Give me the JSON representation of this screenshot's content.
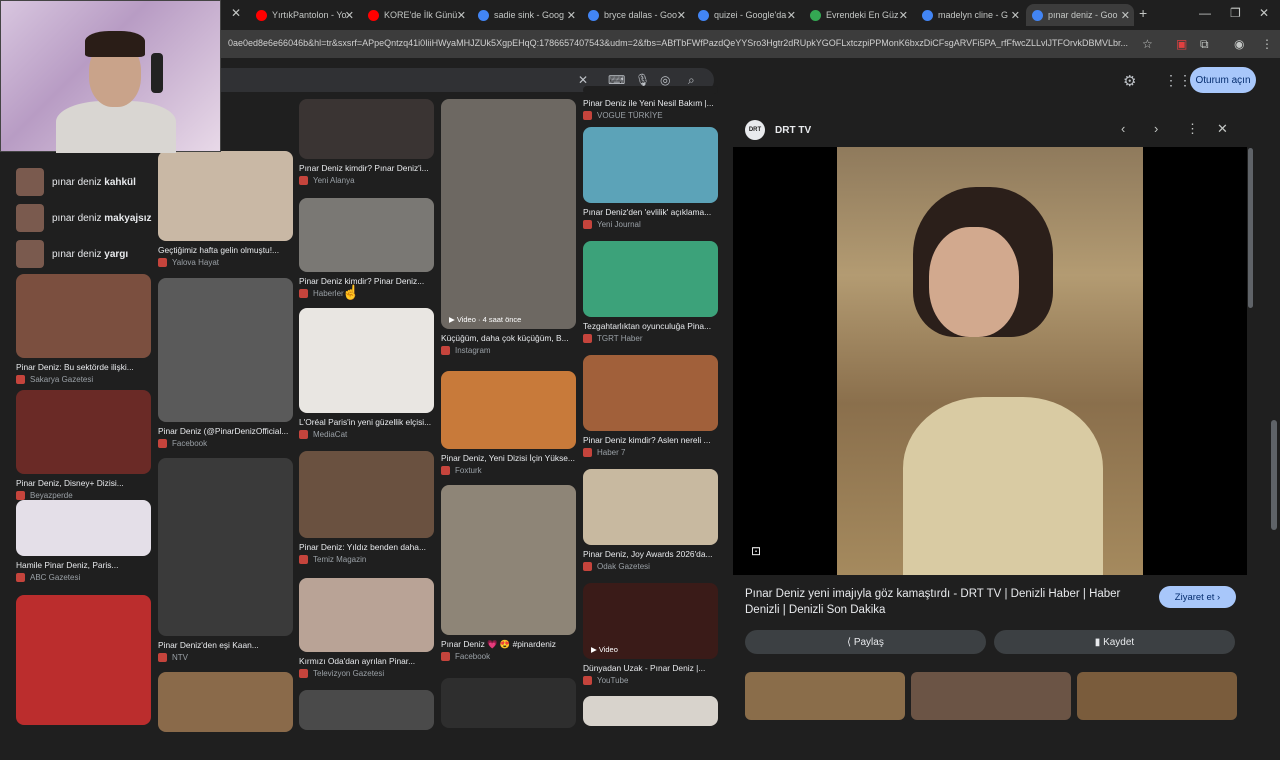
{
  "browser": {
    "tabs": [
      {
        "label": "YırtıkPantolon - Yo",
        "color": "#ff0000"
      },
      {
        "label": "KORE'de İlk Günü",
        "color": "#ff0000"
      },
      {
        "label": "sadie sink - Goog",
        "color": "#4285f4"
      },
      {
        "label": "bryce dallas - Goo",
        "color": "#4285f4"
      },
      {
        "label": "quizei - Google'da",
        "color": "#4285f4"
      },
      {
        "label": "Evrendeki En Güz",
        "color": "#34a853"
      },
      {
        "label": "madelyn cline - G",
        "color": "#4285f4"
      },
      {
        "label": "pınar deniz - Goo",
        "color": "#4285f4"
      }
    ],
    "url": "0ae0ed8e6e66046b&hl=tr&sxsrf=APpeQntzq41i0IiiHWyaMHJZUk5XgpEHqQ:1786657407543&udm=2&fbs=ABfTbFWfPazdQeYYSro3Hgtr2dRUpkYGOFLxtczpiPPMonK6bxzDiCFsgARVFi5PA_rfFfwcZLLvlJTFOrvkDBMVLbr..."
  },
  "header": {
    "signin_label": "Oturum açın"
  },
  "related": [
    {
      "prefix": "pınar deniz ",
      "bold": "kahkül"
    },
    {
      "prefix": "pınar deniz ",
      "bold": "makyajsız"
    },
    {
      "prefix": "pınar deniz ",
      "bold": "yargı"
    }
  ],
  "results": {
    "col1": [
      {
        "cap": "Pinar Deniz: Bu sektörde ilişki...",
        "src": "Sakarya Gazetesi",
        "c": "#7b4f3f"
      },
      {
        "cap": "Pinar Deniz, Disney+ Dizisi...",
        "src": "Beyazperde",
        "c": "#6a2a26"
      },
      {
        "cap": "Hamile Pinar Deniz, Paris...",
        "src": "ABC Gazetesi",
        "c": "#e4dfe8"
      },
      {
        "cap": "",
        "src": "",
        "c": "#bb2d2d"
      }
    ],
    "col2": [
      {
        "cap": "Geçtiğimiz hafta gelin olmuştu!...",
        "src": "Yalova Hayat",
        "c": "#c9b8a5"
      },
      {
        "cap": "Pinar Deniz (@PinarDenizOfficial...",
        "src": "Facebook",
        "c": "#5a5a5a"
      },
      {
        "cap": "Pinar Deniz'den eşi Kaan...",
        "src": "NTV",
        "c": "#3a3a3a"
      },
      {
        "cap": "",
        "src": "",
        "c": "#8a6a4a"
      }
    ],
    "col3": [
      {
        "cap": "Pınar Deniz kimdir? Pınar Deniz'i...",
        "src": "Yeni Alanya",
        "c": "#3a3433"
      },
      {
        "cap": "Pinar Deniz kimdir? Pinar Deniz...",
        "src": "Haberler",
        "c": "#7a7874"
      },
      {
        "cap": "L'Oréal Paris'in yeni güzellik elçisi...",
        "src": "MediaCat",
        "c": "#e9e6e2"
      },
      {
        "cap": "Pinar Deniz: Yıldız benden daha...",
        "src": "Temiz Magazin",
        "c": "#6a5140"
      },
      {
        "cap": "Kırmızı Oda'dan ayrılan Pinar...",
        "src": "Televizyon Gazetesi",
        "c": "#b9a396"
      },
      {
        "cap": "",
        "src": "",
        "c": "#4a4a4a"
      }
    ],
    "col4": [
      {
        "cap": "Küçüğüm, daha çok küçüğüm, B...",
        "src": "Instagram",
        "c": "#6d6862",
        "video": "Video · 4 saat önce"
      },
      {
        "cap": "Pinar Deniz, Yeni Dizisi İçin Yükse...",
        "src": "Foxturk",
        "c": "#c87a3a"
      },
      {
        "cap": "Pınar Deniz 💗 😍 #pinardeniz",
        "src": "Facebook",
        "c": "#8e8577"
      },
      {
        "cap": "",
        "src": "",
        "c": "#2e2e2e"
      }
    ],
    "col5": [
      {
        "cap": "Pinar Deniz ile Yeni Nesil Bakım |...",
        "src": "VOGUE TÜRKİYE",
        "c": "#1f1f1f"
      },
      {
        "cap": "Pınar Deniz'den 'evlilik' açıklama...",
        "src": "Yeni Journal",
        "c": "#5ca3b8"
      },
      {
        "cap": "Tezgahtarlıktan oyunculuğa Pina...",
        "src": "TGRT Haber",
        "c": "#3ca27a"
      },
      {
        "cap": "Pinar Deniz kimdir? Aslen nereli ...",
        "src": "Haber 7",
        "c": "#a1603a"
      },
      {
        "cap": "Pinar Deniz, Joy Awards 2026'da...",
        "src": "Odak Gazetesi",
        "c": "#c8b9a0"
      },
      {
        "cap": "Dünyadan Uzak - Pınar Deniz |...",
        "src": "YouTube",
        "c": "#3a1b18",
        "video": "Video"
      },
      {
        "cap": "",
        "src": "",
        "c": "#d8d3cc"
      }
    ]
  },
  "panel": {
    "source": "DRT TV",
    "logo_text": "DRT",
    "title": "Pınar Deniz yeni imajıyla göz kamaştırdı - DRT TV | Denizli Haber | Haber Denizli | Denizli Son Dakika",
    "visit_label": "Ziyaret et",
    "share_label": "Paylaş",
    "save_label": "Kaydet"
  }
}
